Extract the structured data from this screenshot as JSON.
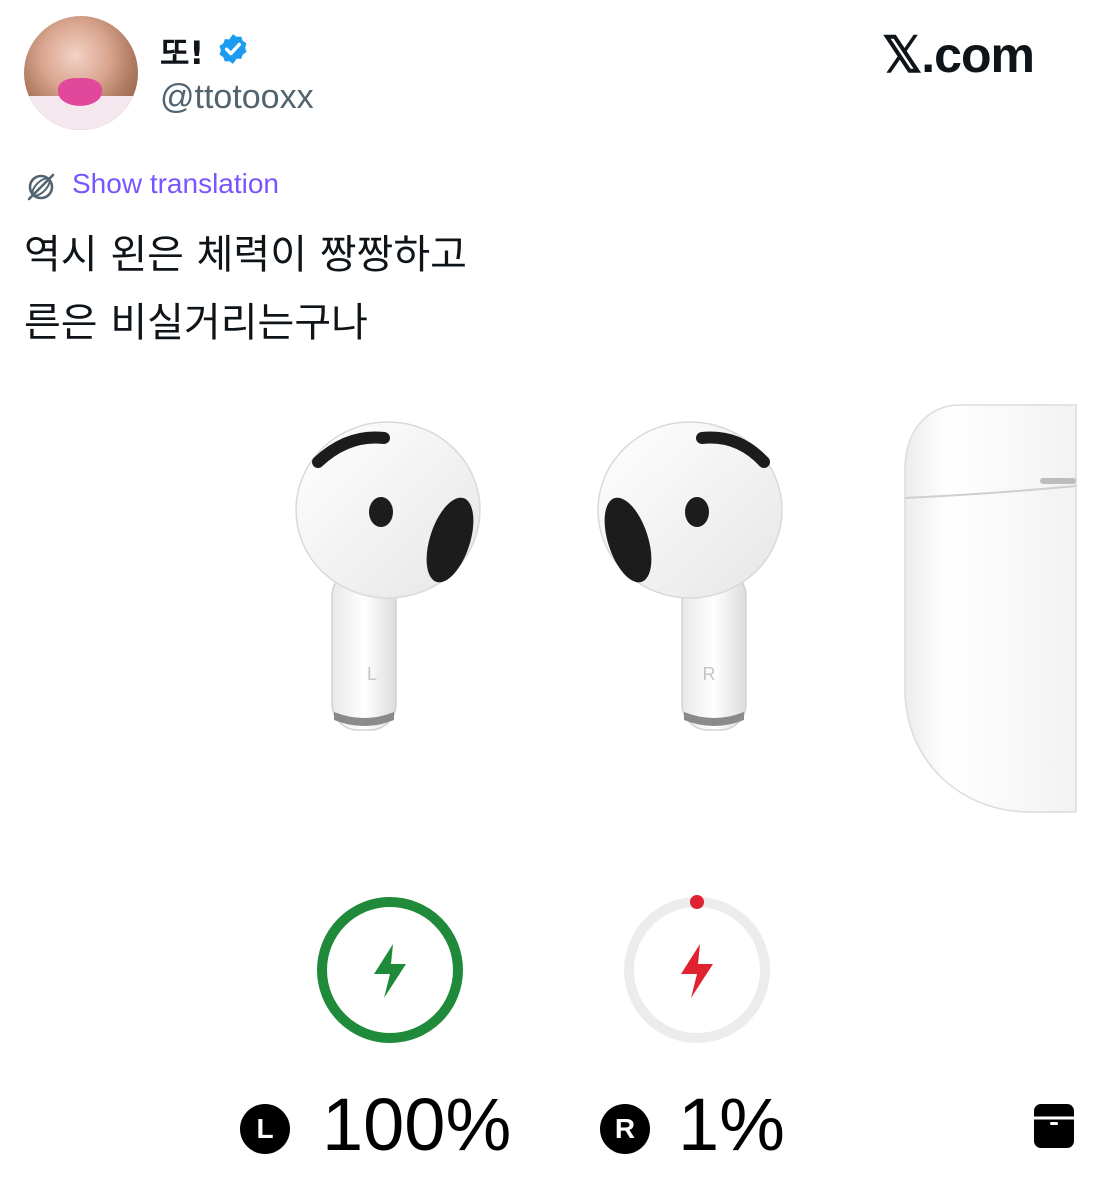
{
  "header": {
    "display_name": "또!",
    "handle": "@ttotooxx",
    "site_label": "𝕏.com"
  },
  "translation": {
    "label": "Show translation"
  },
  "tweet": {
    "lines": [
      "역시 왼은 체력이 짱짱하고",
      "른은 비실거리는구나"
    ]
  },
  "airpods": {
    "left": {
      "badge": "L",
      "stem_label": "L",
      "percent_text": "100%",
      "level": 1.0,
      "color": "#1f8a3a"
    },
    "right": {
      "badge": "R",
      "stem_label": "R",
      "percent_text": "1%",
      "level": 0.01,
      "color": "#e0212f"
    },
    "case_icon": "case-icon"
  },
  "colors": {
    "link": "#7856ff",
    "verified": "#1d9bf0",
    "secondary_text": "#536471"
  }
}
